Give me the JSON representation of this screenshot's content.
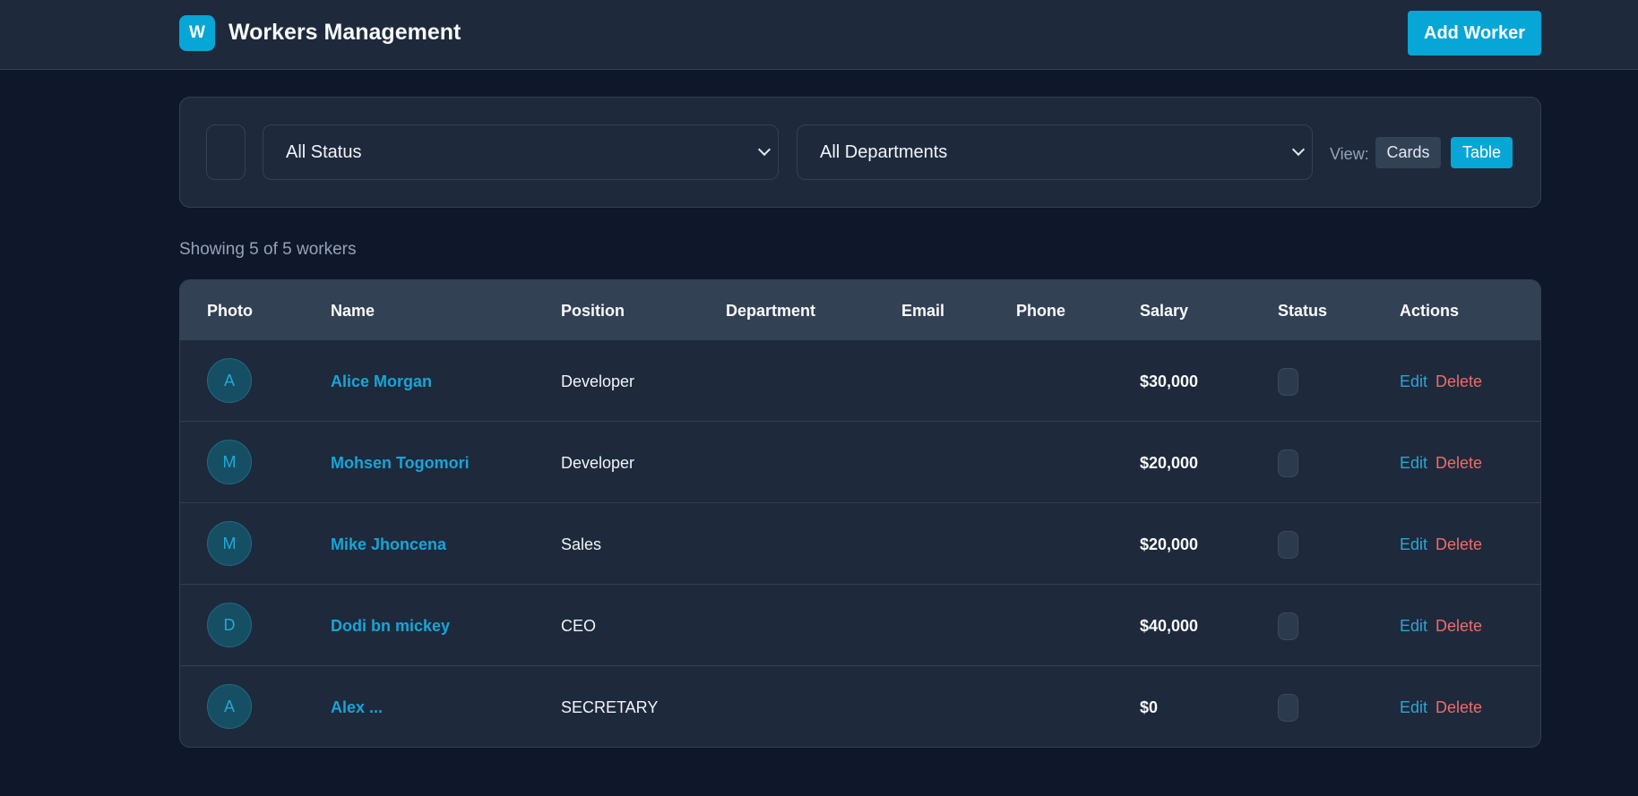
{
  "header": {
    "logo_letter": "W",
    "title": "Workers Management",
    "add_button": "Add Worker"
  },
  "filters": {
    "status_selected": "All Status",
    "department_selected": "All Departments",
    "view_label": "View:",
    "view_cards": "Cards",
    "view_table": "Table",
    "active_view": "Table"
  },
  "summary": {
    "showing": "Showing 5 of 5 workers"
  },
  "table": {
    "columns": [
      "Photo",
      "Name",
      "Position",
      "Department",
      "Email",
      "Phone",
      "Salary",
      "Status",
      "Actions"
    ],
    "rows": [
      {
        "initial": "A",
        "name": "Alice Morgan",
        "position": "Developer",
        "salary": "$30,000",
        "edit": "Edit",
        "delete": "Delete"
      },
      {
        "initial": "M",
        "name": "Mohsen Togomori",
        "position": "Developer",
        "salary": "$20,000",
        "edit": "Edit",
        "delete": "Delete"
      },
      {
        "initial": "M",
        "name": "Mike Jhoncena",
        "position": "Sales",
        "salary": "$20,000",
        "edit": "Edit",
        "delete": "Delete"
      },
      {
        "initial": "D",
        "name": "Dodi bn mickey",
        "position": "CEO",
        "salary": "$40,000",
        "edit": "Edit",
        "delete": "Delete"
      },
      {
        "initial": "A",
        "name": "Alex ...",
        "position": "SECRETARY",
        "salary": "$0",
        "edit": "Edit",
        "delete": "Delete"
      }
    ]
  },
  "colors": {
    "accent": "#06a6d6",
    "background": "#0f172a",
    "panel": "#1e293b",
    "danger": "#f06b6b"
  }
}
